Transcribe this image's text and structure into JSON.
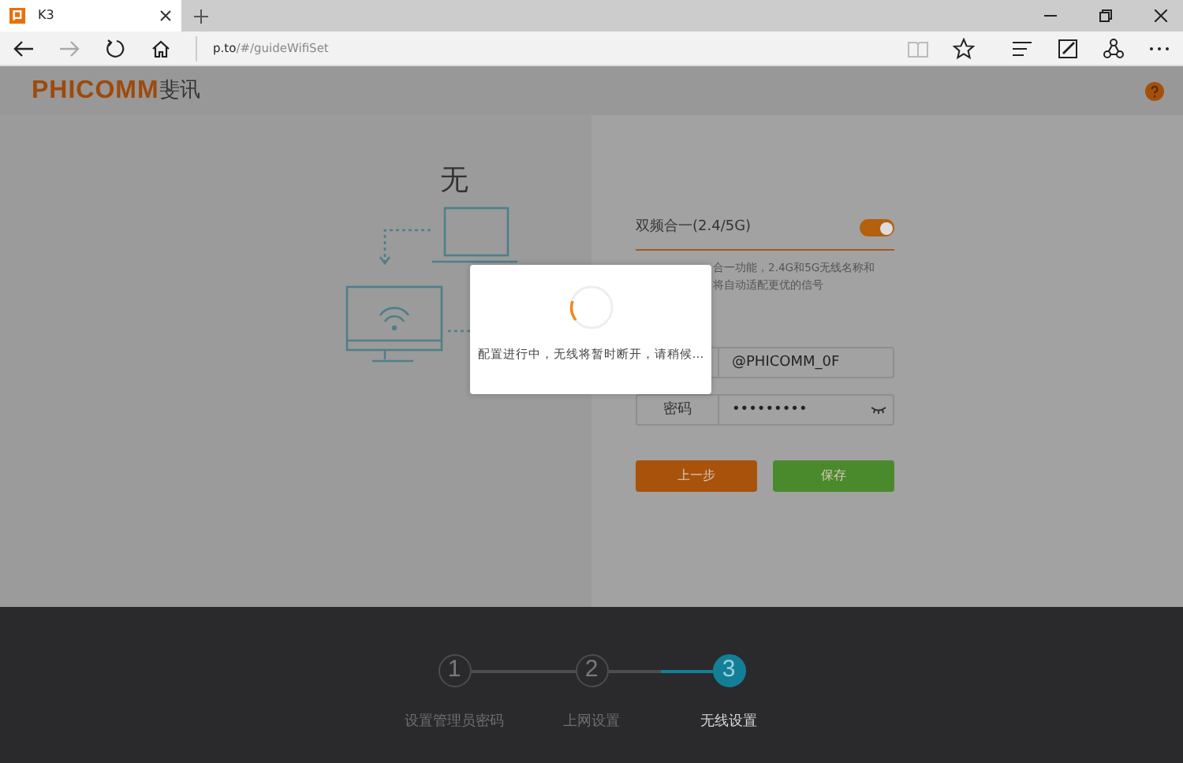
{
  "browser": {
    "tab": {
      "title": "K3"
    },
    "address": {
      "host": "p.to",
      "path": "/#/guideWifiSet"
    }
  },
  "header": {
    "brand": "PHICOMM",
    "brand_cn": "斐讯"
  },
  "left": {
    "title": "无"
  },
  "form": {
    "dual_band": {
      "label": "双频合一(2.4/5G)",
      "on": true
    },
    "description": [
      "合一功能，2.4G和5G无线名称和",
      "将自动适配更优的信号"
    ],
    "ssid": {
      "value": "@PHICOMM_0F"
    },
    "password": {
      "label": "密码",
      "value": "•••••••••"
    },
    "buttons": [
      {
        "label": "上一步",
        "kind": "back"
      },
      {
        "label": "保存",
        "kind": "save"
      }
    ]
  },
  "modal": {
    "message": "配置进行中，无线将暂时断开，请稍候..."
  },
  "steps": [
    {
      "number": "1",
      "label": "设置管理员密码",
      "selected": false
    },
    {
      "number": "2",
      "label": "上网设置",
      "selected": false
    },
    {
      "number": "3",
      "label": "无线设置",
      "selected": true
    }
  ]
}
